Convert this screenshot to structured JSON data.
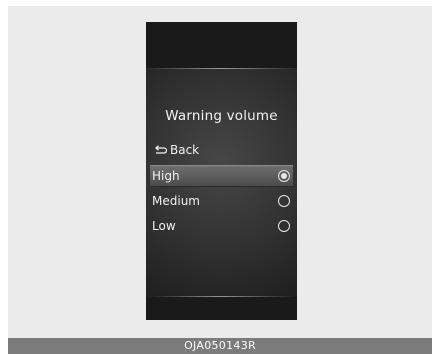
{
  "menu": {
    "title": "Warning volume",
    "back_label": "Back",
    "options": [
      {
        "label": "High",
        "selected": true
      },
      {
        "label": "Medium",
        "selected": false
      },
      {
        "label": "Low",
        "selected": false
      }
    ]
  },
  "caption": "OJA050143R",
  "colors": {
    "page_background": "#ebebeb",
    "screen_background": "#1a1a1a",
    "text": "#f2f2f2",
    "caption_bar": "#7b7b7b"
  },
  "icons": {
    "back": "return-arrow-icon",
    "selected_option": "radio-selected-icon",
    "unselected_option": "radio-empty-icon"
  }
}
